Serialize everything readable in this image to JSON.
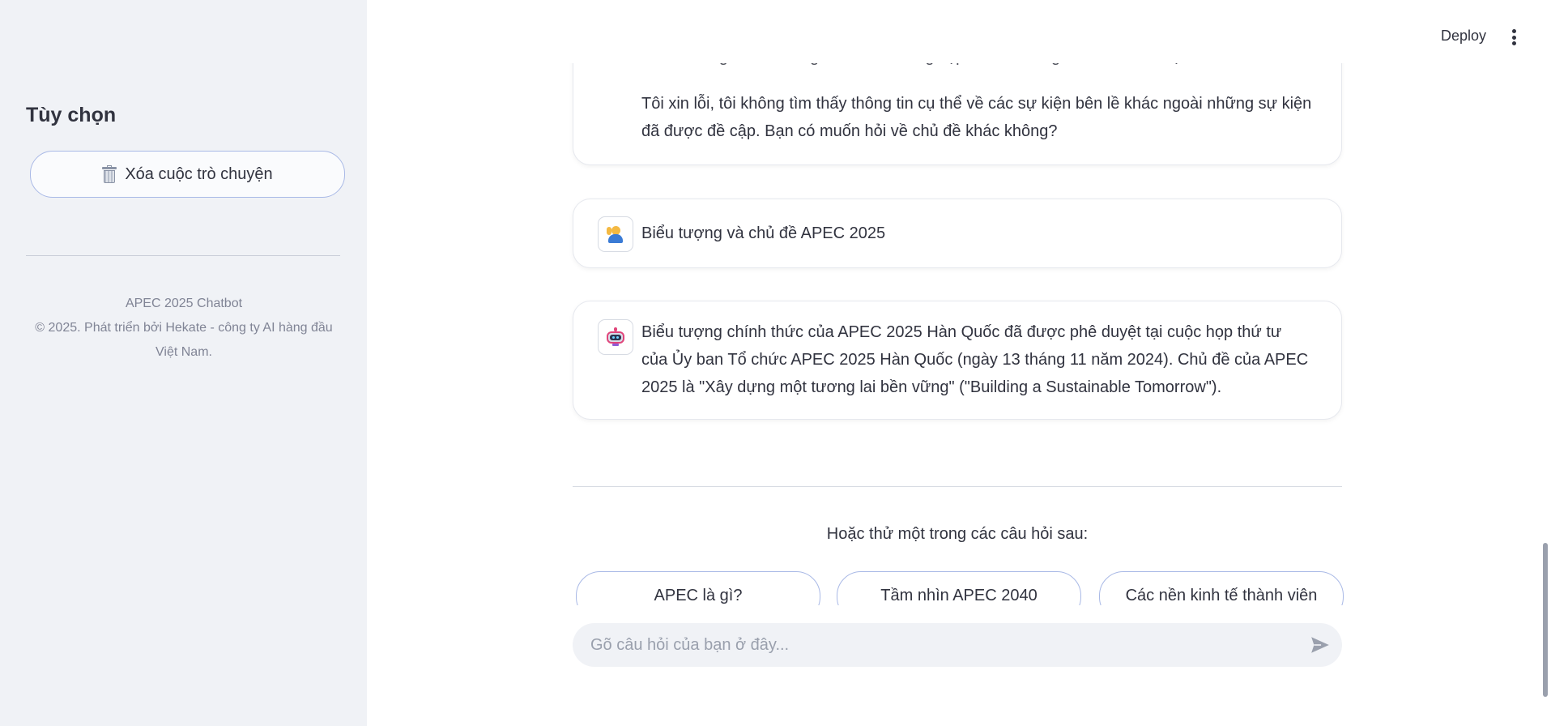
{
  "sidebar": {
    "title": "Tùy chọn",
    "clear_button_label": "Xóa cuộc trò chuyện",
    "clear_button_icon": "trash-icon",
    "footer_line1": "APEC 2025 Chatbot",
    "footer_line2": "© 2025. Phát triển bởi Hekate - công ty AI hàng đầu Việt Nam."
  },
  "header": {
    "deploy_label": "Deploy",
    "menu_icon": "kebab-menu-icon"
  },
  "messages": [
    {
      "role": "assistant",
      "clipped_text": "chương trình tham gia của doanh nghiệp diễn ra trong Tuần lễ Lãnh đạo Kinh tế APEC.",
      "text": "Tôi xin lỗi, tôi không tìm thấy thông tin cụ thể về các sự kiện bên lề khác ngoài những sự kiện đã được đề cập. Bạn có muốn hỏi về chủ đề khác không?"
    },
    {
      "role": "user",
      "avatar_icon": "user-raising-hand-icon",
      "text": "Biểu tượng và chủ đề APEC 2025"
    },
    {
      "role": "assistant",
      "avatar_icon": "robot-icon",
      "text": "Biểu tượng chính thức của APEC 2025 Hàn Quốc đã được phê duyệt tại cuộc họp thứ tư của Ủy ban Tổ chức APEC 2025 Hàn Quốc (ngày 13 tháng 11 năm 2024). Chủ đề của APEC 2025 là \"Xây dựng một tương lai bền vững\" (\"Building a Sustainable Tomorrow\")."
    }
  ],
  "suggestions": {
    "title": "Hoặc thử một trong các câu hỏi sau:",
    "items": [
      "APEC là gì?",
      "Tầm nhìn APEC 2040",
      "Các nền kinh tế thành viên"
    ]
  },
  "chat_input": {
    "placeholder": "Gõ câu hỏi của bạn ở đây...",
    "send_icon": "send-icon"
  },
  "colors": {
    "sidebar_bg": "#f0f2f6",
    "button_border": "#a9b9e6",
    "text": "#31333f"
  }
}
